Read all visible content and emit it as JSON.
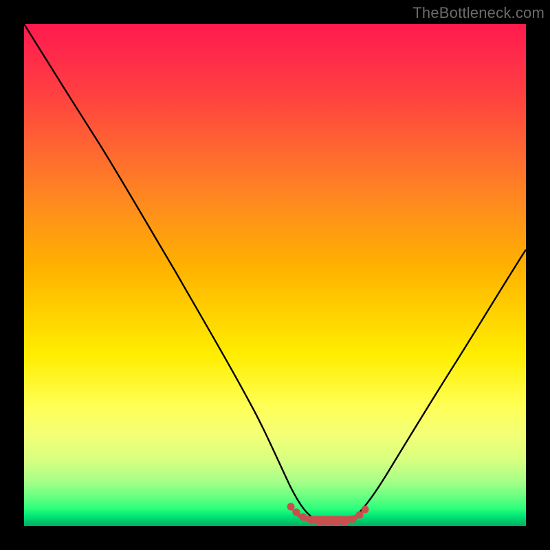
{
  "watermark": "TheBottleneck.com",
  "chart_data": {
    "type": "line",
    "title": "",
    "xlabel": "",
    "ylabel": "",
    "xlim": [
      0,
      100
    ],
    "ylim": [
      0,
      100
    ],
    "grid": false,
    "legend": false,
    "series": [
      {
        "name": "bottleneck-curve",
        "color": "#000000",
        "x": [
          0,
          5,
          10,
          15,
          20,
          25,
          30,
          35,
          40,
          45,
          50,
          52,
          55,
          58,
          60,
          62,
          65,
          68,
          72,
          78,
          85,
          92,
          100
        ],
        "y": [
          100,
          92,
          84,
          76,
          68,
          59,
          50,
          41,
          32,
          23,
          13,
          8,
          3,
          1,
          0,
          0,
          1,
          4,
          10,
          20,
          33,
          46,
          60
        ]
      },
      {
        "name": "optimal-zone",
        "color": "#c94f4f",
        "x": [
          52,
          54,
          56,
          58,
          60,
          62,
          64,
          65
        ],
        "y": [
          4,
          2,
          1,
          0.5,
          0.3,
          0.5,
          1.5,
          3
        ]
      }
    ],
    "background_gradient": {
      "top": "#ff1a4d",
      "middle": "#ffd300",
      "bottom": "#00b060"
    }
  }
}
